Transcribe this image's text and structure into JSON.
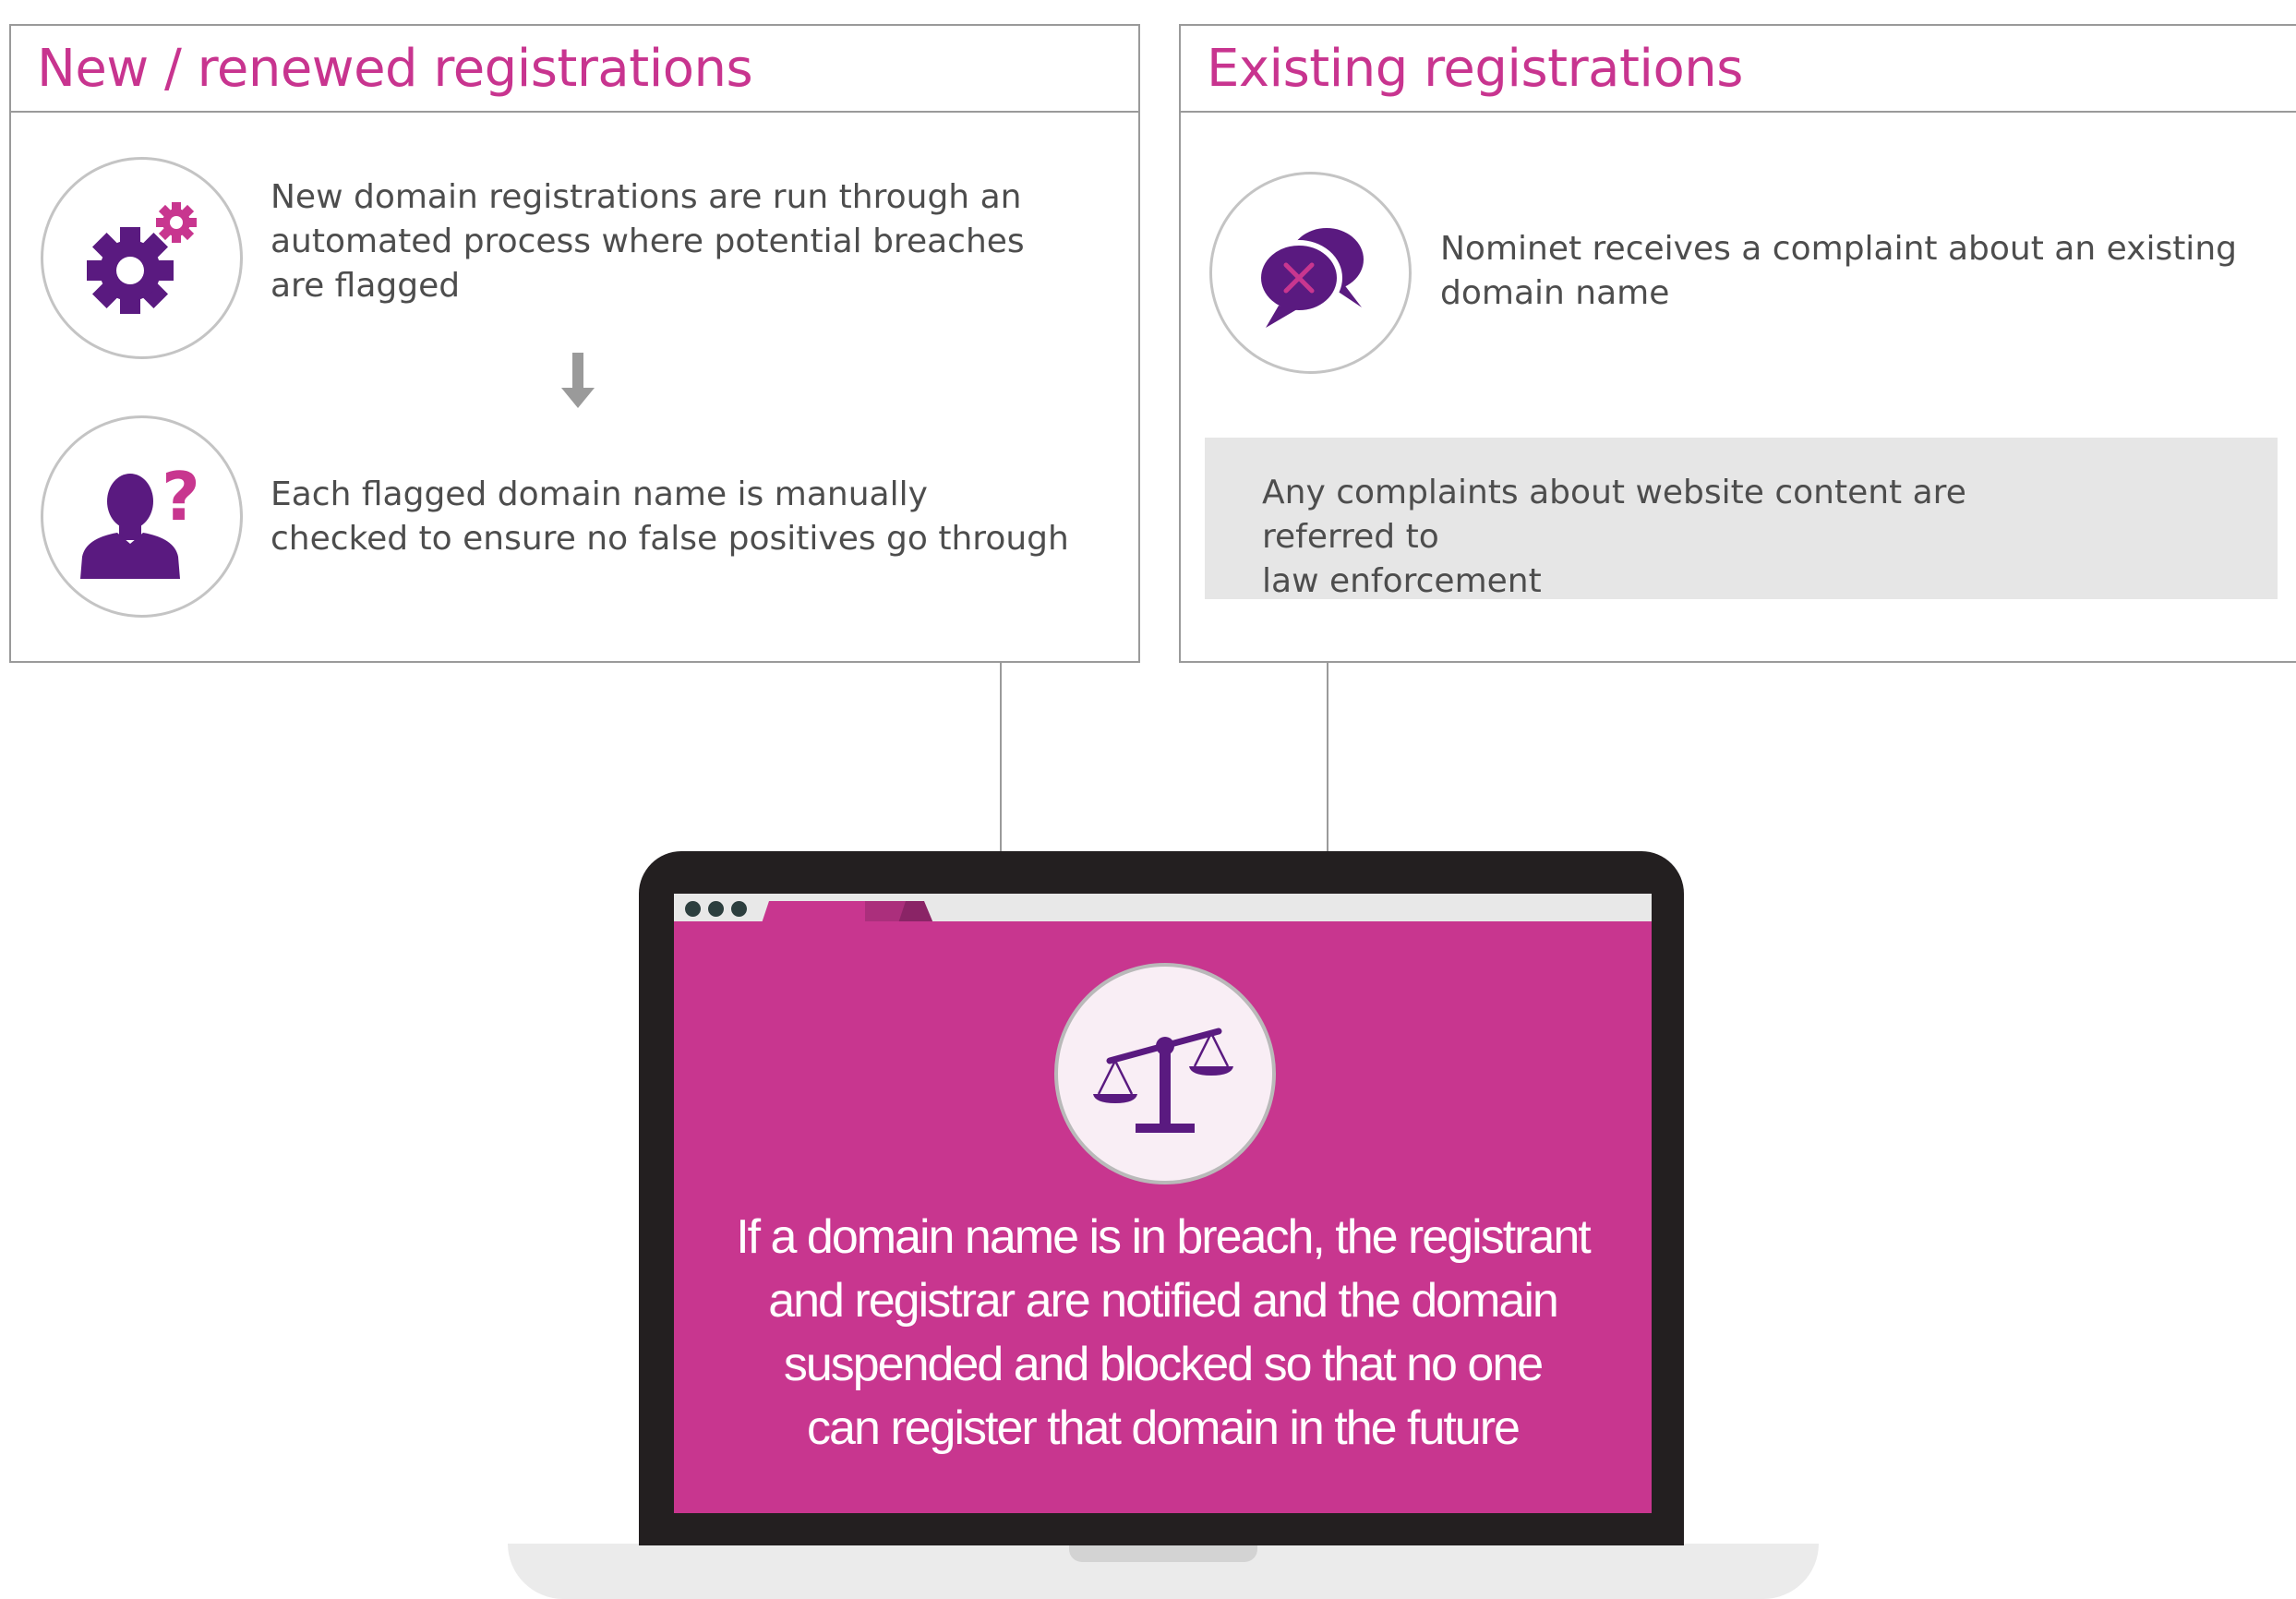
{
  "left_panel": {
    "title": "New / renewed registrations",
    "steps": [
      {
        "icon": "gears-icon",
        "lines": [
          "New domain registrations are run through an",
          "automated process where potential breaches",
          "are flagged"
        ]
      },
      {
        "icon": "person-question-icon",
        "lines": [
          "Each flagged domain name is manually",
          "checked to ensure no false positives go through"
        ]
      }
    ]
  },
  "right_panel": {
    "title": "Existing registrations",
    "complaint": {
      "icon": "speech-bubbles-cross-icon",
      "lines": [
        "Nominet receives a complaint about an existing",
        "domain name"
      ]
    },
    "info_box": {
      "lines": [
        "Any complaints about website content are referred to",
        "law enforcement"
      ]
    }
  },
  "laptop": {
    "icon": "scales-icon",
    "lines": [
      "If a domain name is in breach, the registrant",
      "and registrar are notified and the domain",
      "suspended and blocked so that no one",
      "can register that domain in the future"
    ]
  },
  "colors": {
    "accent_pink": "#c8368f",
    "icon_purple": "#5a1a80",
    "border_gray": "#9a9a9a",
    "text_gray": "#4d4d4d",
    "info_bg": "#e6e6e6",
    "laptop_dark": "#231f20"
  }
}
